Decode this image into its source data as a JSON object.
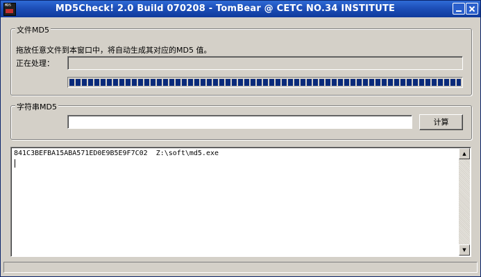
{
  "window": {
    "title": "MD5Check! 2.0 Build 070208 - TomBear @ CETC NO.34 INSTITUTE",
    "icon_text": "MD5",
    "icon": "app-icon",
    "minimize_icon": "minimize-icon",
    "close_icon": "close-icon"
  },
  "file_group": {
    "label": "文件MD5",
    "hint": "拖放任意文件到本窗口中，将自动生成其对应的MD5 值。",
    "processing_label": "正在处理：",
    "processing_value": "",
    "progress": 1.0
  },
  "string_group": {
    "label": "字符串MD5",
    "input_value": "",
    "input_placeholder": "",
    "compute_button": "计算"
  },
  "output": {
    "text": "841C3BEFBA15ABA571ED0E9B5E9F7C02  Z:\\soft\\md5.exe"
  },
  "scrollbar": {
    "up_icon": "▲",
    "down_icon": "▼"
  },
  "status": {
    "text": ""
  },
  "colors": {
    "title_bar": "#1d4fb8",
    "face": "#d4d0c8",
    "progress": "#0a2a7a"
  }
}
